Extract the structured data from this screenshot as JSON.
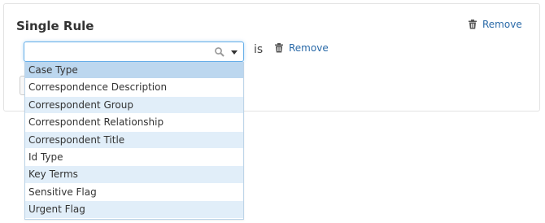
{
  "panel": {
    "title": "Single Rule",
    "remove_label": "Remove"
  },
  "rule": {
    "operator_label": "is",
    "remove_label": "Remove",
    "field_value": ""
  },
  "dropdown": {
    "items": [
      "Case Type",
      "Correspondence Description",
      "Correspondent Group",
      "Correspondent Relationship",
      "Correspondent Title",
      "Id Type",
      "Key Terms",
      "Sensitive Flag",
      "Urgent Flag"
    ],
    "highlighted_index": 0
  },
  "colors": {
    "link": "#2a6aa8",
    "focus_border": "#66afe9",
    "row_alt": "#e1eef9",
    "row_selected": "#bcd7ef"
  },
  "icons": {
    "trash": "trash-icon",
    "search": "search-icon",
    "caret": "chevron-down-icon"
  }
}
